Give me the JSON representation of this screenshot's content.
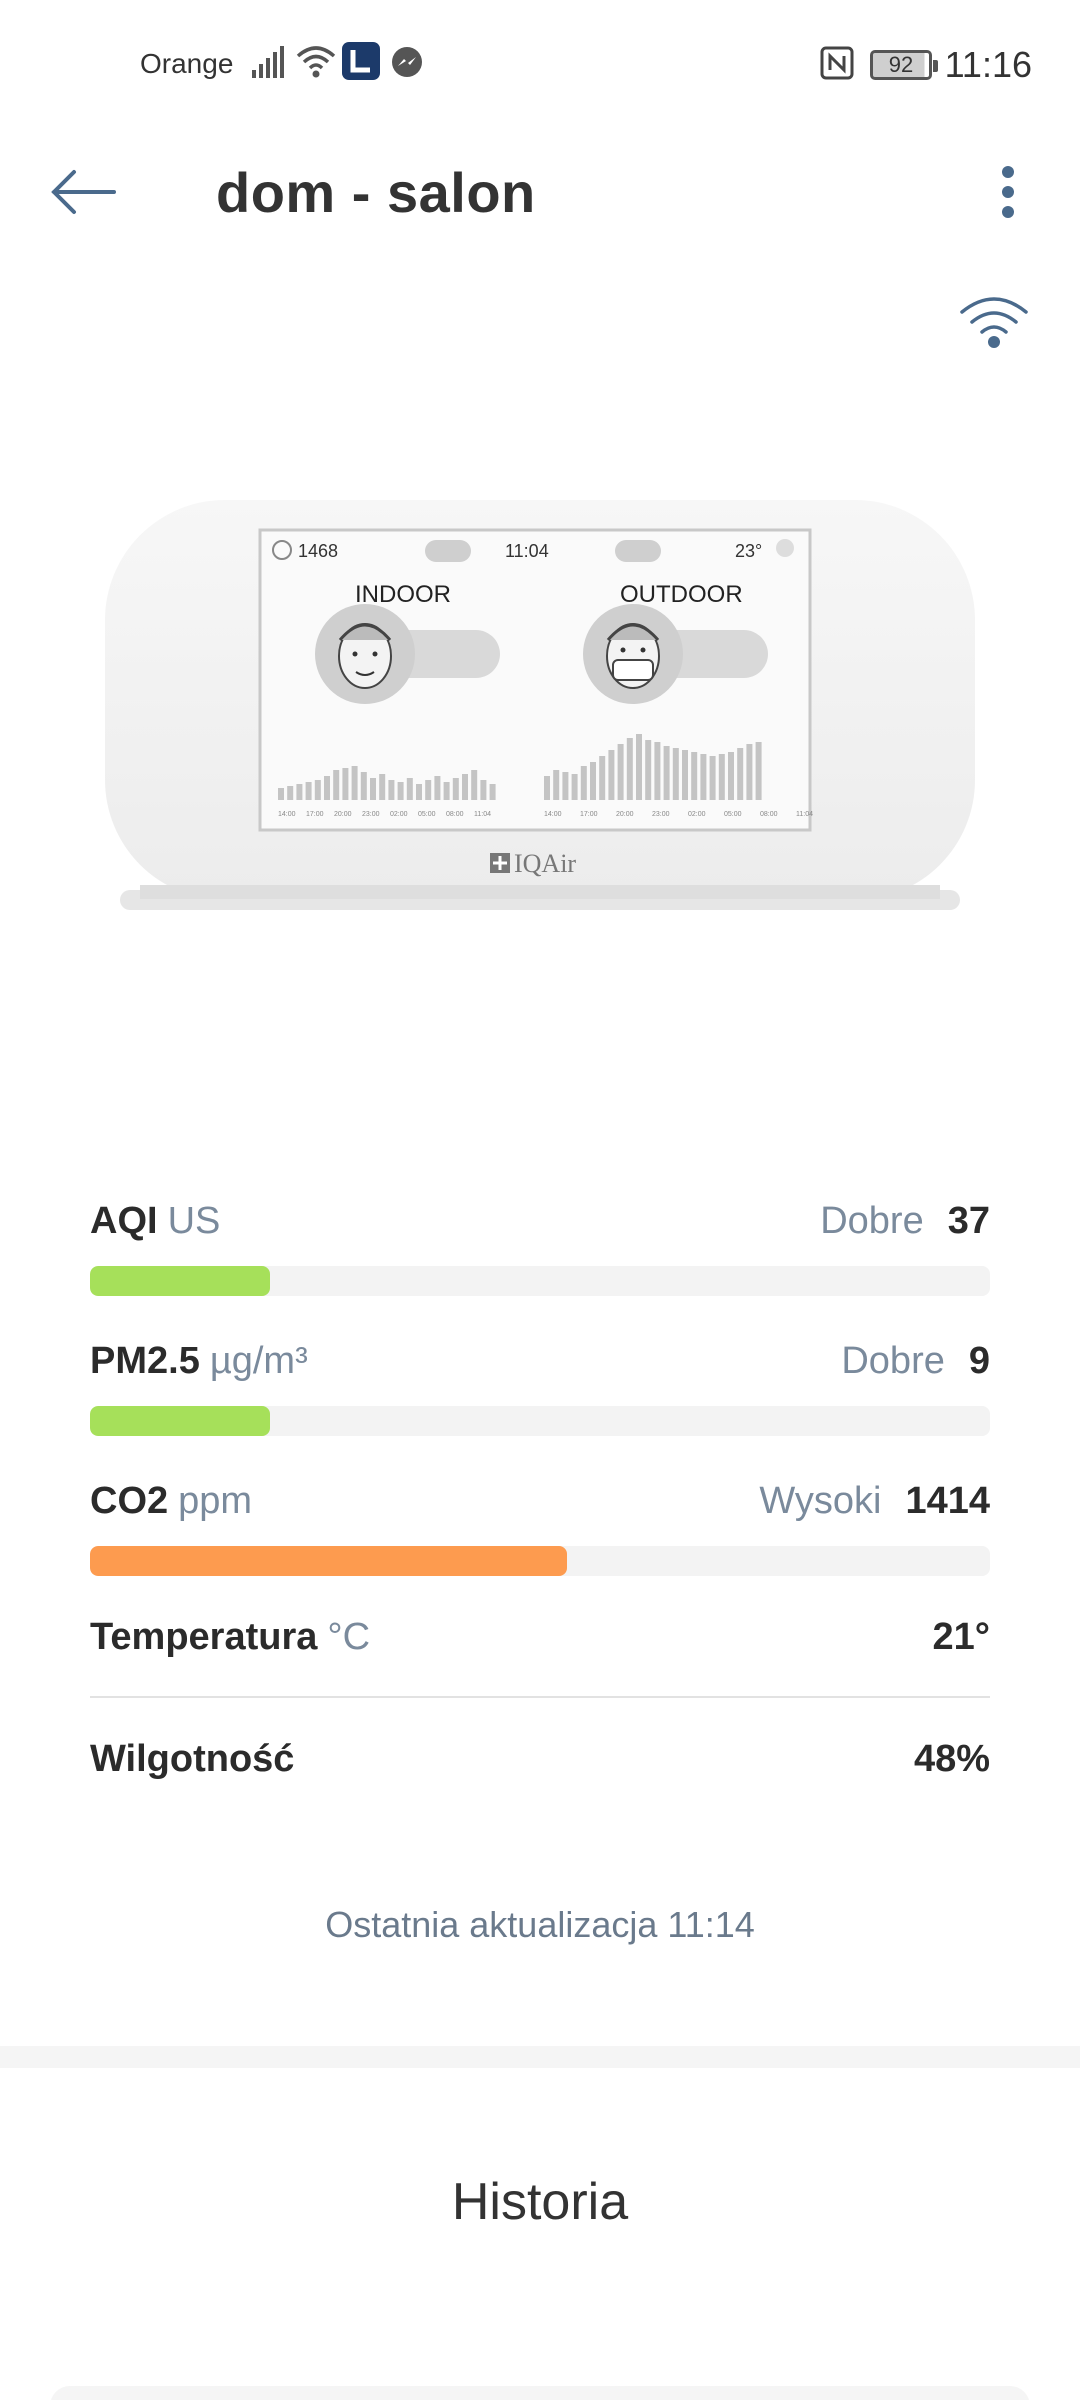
{
  "status_bar": {
    "carrier": "Orange",
    "battery": "92",
    "time": "11:16",
    "icons": [
      "signal-icon",
      "wifi-icon",
      "app-notification-icon",
      "messenger-icon",
      "nfc-icon",
      "battery-icon"
    ]
  },
  "header": {
    "title": "dom - salon",
    "back_icon": "arrow-left-icon",
    "more_icon": "more-vert-icon",
    "wifi_icon": "wifi-icon"
  },
  "device_screen": {
    "fan_value": "1468",
    "time": "11:04",
    "temperature": "23°",
    "indoor_label": "INDOOR",
    "outdoor_label": "OUTDOOR",
    "brand": "IQAir",
    "chart_ticks": [
      "14:00",
      "17:00",
      "20:00",
      "23:00",
      "02:00",
      "05:00",
      "08:00",
      "11:04"
    ]
  },
  "metrics": {
    "aqi": {
      "label": "AQI",
      "unit": "US",
      "status": "Dobre",
      "value": "37",
      "level": 0.2,
      "color": "#a6e05a"
    },
    "pm25": {
      "label": "PM2.5",
      "unit": "µg/m³",
      "status": "Dobre",
      "value": "9",
      "level": 0.2,
      "color": "#a6e05a"
    },
    "co2": {
      "label": "CO2",
      "unit": "ppm",
      "status": "Wysoki",
      "value": "1414",
      "level": 0.53,
      "color": "#fd9b4f"
    },
    "temperature": {
      "label": "Temperatura",
      "unit": "°C",
      "value": "21°"
    },
    "humidity": {
      "label": "Wilgotność",
      "value": "48%"
    }
  },
  "last_update": "Ostatnia aktualizacja 11:14",
  "history_title": "Historia"
}
